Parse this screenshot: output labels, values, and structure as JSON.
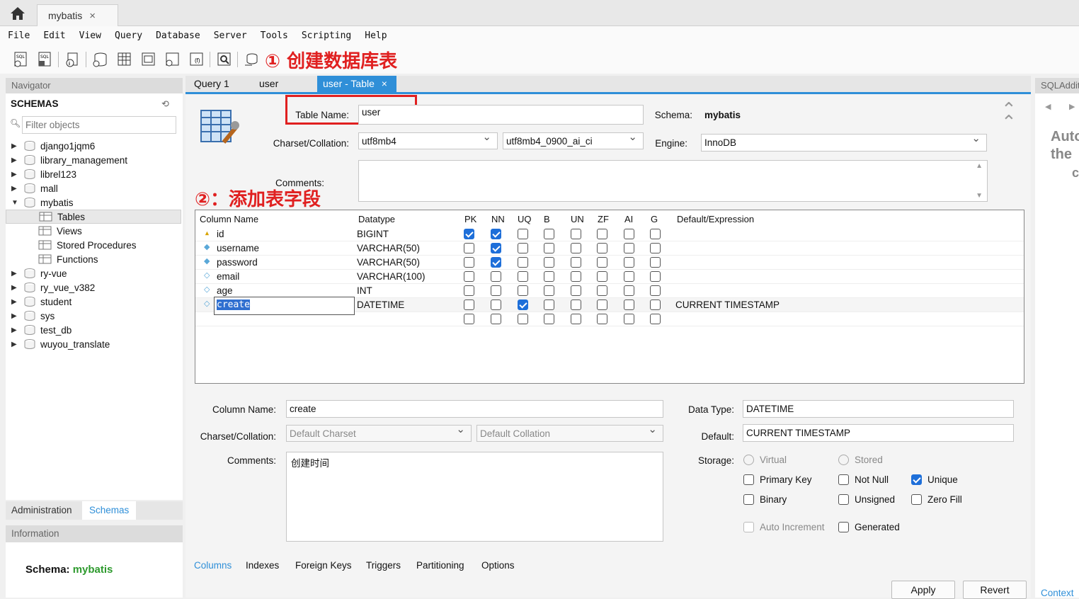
{
  "tab": {
    "name": "mybatis",
    "close": "×"
  },
  "menu": [
    "File",
    "Edit",
    "View",
    "Query",
    "Database",
    "Server",
    "Tools",
    "Scripting",
    "Help"
  ],
  "annotations": {
    "step1": "① 创建数据库表",
    "step2": "②：添加表字段"
  },
  "colors": {
    "accent": "#2f8fd8",
    "annotation": "#e02020",
    "schema_green": "#2e9a2e"
  },
  "navigator": {
    "title": "Navigator",
    "schemas_label": "SCHEMAS",
    "filter_placeholder": "Filter objects",
    "tree": [
      {
        "label": "django1jqm6",
        "expanded": false
      },
      {
        "label": "library_management",
        "expanded": false
      },
      {
        "label": "librel123",
        "expanded": false
      },
      {
        "label": "mall",
        "expanded": false
      },
      {
        "label": "mybatis",
        "expanded": true
      },
      {
        "label": "Tables",
        "child": true,
        "selected": true
      },
      {
        "label": "Views",
        "child": true
      },
      {
        "label": "Stored Procedures",
        "child": true
      },
      {
        "label": "Functions",
        "child": true
      },
      {
        "label": "ry-vue",
        "expanded": false
      },
      {
        "label": "ry_vue_v382",
        "expanded": false
      },
      {
        "label": "student",
        "expanded": false
      },
      {
        "label": "sys",
        "expanded": false
      },
      {
        "label": "test_db",
        "expanded": false
      },
      {
        "label": "wuyou_translate",
        "expanded": false
      }
    ],
    "bottom_tabs": [
      "Administration",
      "Schemas"
    ],
    "info_title": "Information",
    "info_schema_label": "Schema:",
    "info_schema_value": "mybatis"
  },
  "editor_tabs": [
    {
      "label": "Query 1"
    },
    {
      "label": "user"
    },
    {
      "label": "user - Table",
      "active": true,
      "close": "×"
    }
  ],
  "table": {
    "name_label": "Table Name:",
    "name": "user",
    "schema_label": "Schema:",
    "schema": "mybatis",
    "charset_label": "Charset/Collation:",
    "charset": "utf8mb4",
    "collation": "utf8mb4_0900_ai_ci",
    "engine_label": "Engine:",
    "engine": "InnoDB",
    "comments_label": "Comments:"
  },
  "grid": {
    "headers": [
      "Column Name",
      "Datatype",
      "PK",
      "NN",
      "UQ",
      "B",
      "UN",
      "ZF",
      "AI",
      "G",
      "Default/Expression"
    ],
    "rows": [
      {
        "icon": "key-icon",
        "name": "id",
        "type": "BIGINT",
        "flags": [
          1,
          1,
          0,
          0,
          0,
          0,
          0,
          0
        ],
        "default": ""
      },
      {
        "icon": "diamond-filled-icon",
        "name": "username",
        "type": "VARCHAR(50)",
        "flags": [
          0,
          1,
          0,
          0,
          0,
          0,
          0,
          0
        ],
        "default": ""
      },
      {
        "icon": "diamond-filled-icon",
        "name": "password",
        "type": "VARCHAR(50)",
        "flags": [
          0,
          1,
          0,
          0,
          0,
          0,
          0,
          0
        ],
        "default": ""
      },
      {
        "icon": "diamond-icon",
        "name": "email",
        "type": "VARCHAR(100)",
        "flags": [
          0,
          0,
          0,
          0,
          0,
          0,
          0,
          0
        ],
        "default": ""
      },
      {
        "icon": "diamond-icon",
        "name": "age",
        "type": "INT",
        "flags": [
          0,
          0,
          0,
          0,
          0,
          0,
          0,
          0
        ],
        "default": ""
      },
      {
        "icon": "diamond-icon",
        "name": "create",
        "type": "DATETIME",
        "flags": [
          0,
          0,
          1,
          0,
          0,
          0,
          0,
          0
        ],
        "default": "CURRENT TIMESTAMP",
        "editing": true
      },
      {
        "icon": "",
        "name": "",
        "type": "",
        "flags": [
          0,
          0,
          0,
          0,
          0,
          0,
          0,
          0
        ],
        "default": ""
      }
    ]
  },
  "details": {
    "col_name_label": "Column Name:",
    "col_name": "create",
    "charset_label": "Charset/Collation:",
    "charset": "Default Charset",
    "collation": "Default Collation",
    "comments_label": "Comments:",
    "comments": "创建时间",
    "type_label": "Data Type:",
    "type": "DATETIME",
    "default_label": "Default:",
    "default": "CURRENT TIMESTAMP",
    "storage_label": "Storage:",
    "virtual": "Virtual",
    "stored": "Stored",
    "primary_key": "Primary Key",
    "not_null": "Not Null",
    "unique": "Unique",
    "binary": "Binary",
    "unsigned": "Unsigned",
    "zero_fill": "Zero Fill",
    "auto_increment": "Auto Increment",
    "generated": "Generated"
  },
  "bottom_tabs": [
    "Columns",
    "Indexes",
    "Foreign Keys",
    "Triggers",
    "Partitioning",
    "Options"
  ],
  "buttons": {
    "apply": "Apply",
    "revert": "Revert"
  },
  "right_panel": {
    "title": "SQLAdditions",
    "text1": "Auto",
    "text2": "the",
    "text3": "c",
    "context": "Context"
  }
}
